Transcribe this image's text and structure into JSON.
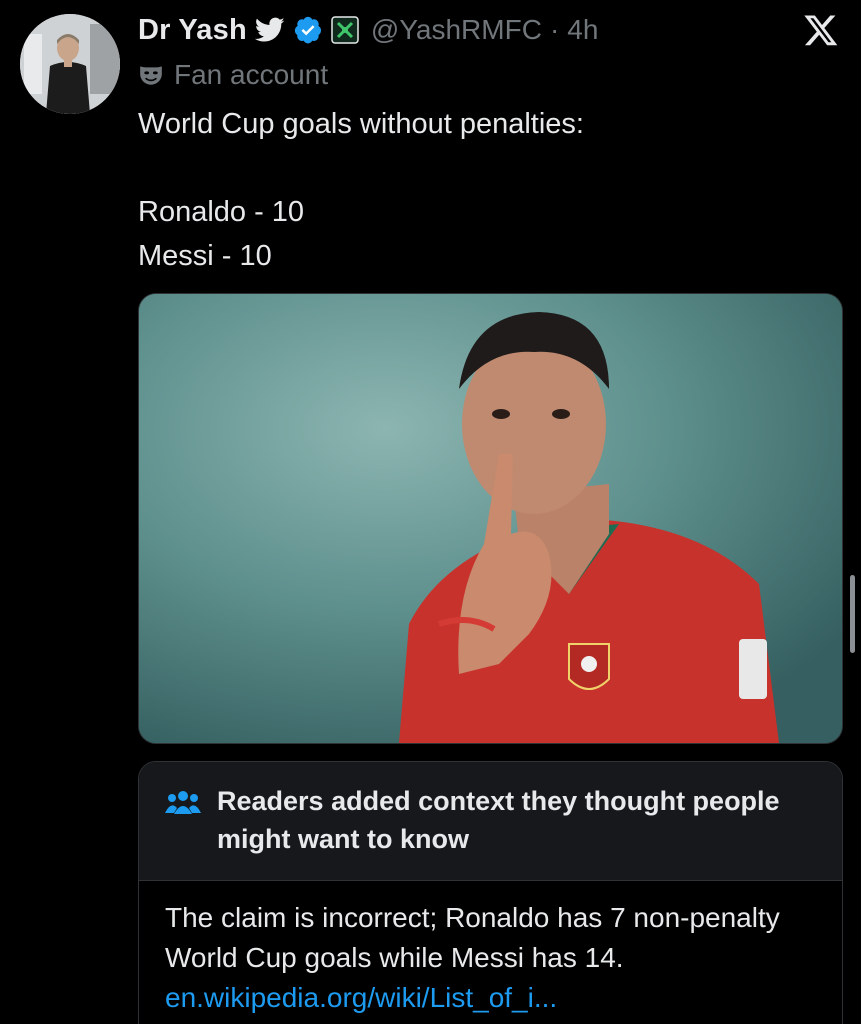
{
  "author": {
    "display_name": "Dr Yash",
    "handle": "@YashRMFC",
    "separator": "·",
    "time": "4h",
    "label": "Fan account"
  },
  "tweet": {
    "lines": [
      "World Cup goals without penalties:",
      "",
      "Ronaldo - 10",
      "Messi - 10"
    ]
  },
  "media": {
    "description_icon": "photo"
  },
  "community_note": {
    "title": "Readers added context they thought people might want to know",
    "body": "The claim is incorrect; Ronaldo has 7 non-penalty World Cup goals while Messi has 14.",
    "link": "en.wikipedia.org/wiki/List_of_i..."
  },
  "colors": {
    "background": "#000000",
    "text": "#e7e9ea",
    "muted": "#71767b",
    "accent": "#1d9bf0",
    "border": "#2f3336",
    "note_header_bg": "#16181c"
  },
  "icons": [
    "twitter-bird-icon",
    "verified-badge-icon",
    "affiliate-badge-icon",
    "x-logo-icon",
    "fan-mask-icon",
    "people-icon"
  ]
}
